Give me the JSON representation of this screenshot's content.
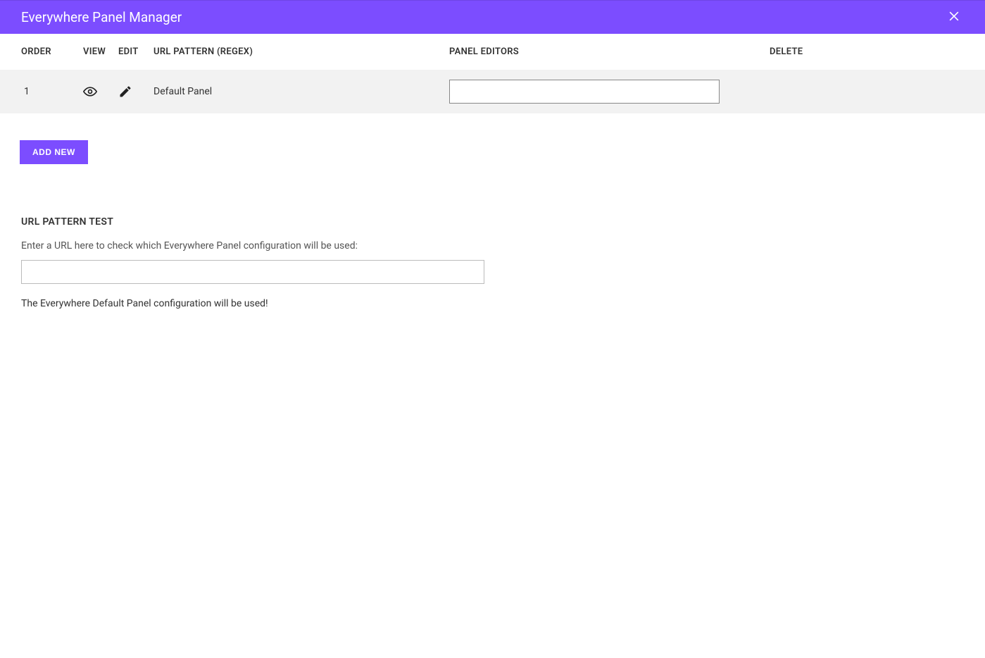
{
  "header": {
    "title": "Everywhere Panel Manager"
  },
  "table": {
    "headers": {
      "order": "ORDER",
      "view": "VIEW",
      "edit": "EDIT",
      "url_pattern": "URL PATTERN (REGEX)",
      "panel_editors": "PANEL EDITORS",
      "delete": "DELETE"
    },
    "rows": [
      {
        "order": "1",
        "url_pattern": "Default Panel",
        "editors_value": ""
      }
    ]
  },
  "buttons": {
    "add_new": "ADD NEW"
  },
  "test_section": {
    "title": "URL PATTERN TEST",
    "instruction": "Enter a URL here to check which Everywhere Panel configuration will be used:",
    "input_value": "",
    "result": "The Everywhere Default Panel configuration will be used!"
  }
}
